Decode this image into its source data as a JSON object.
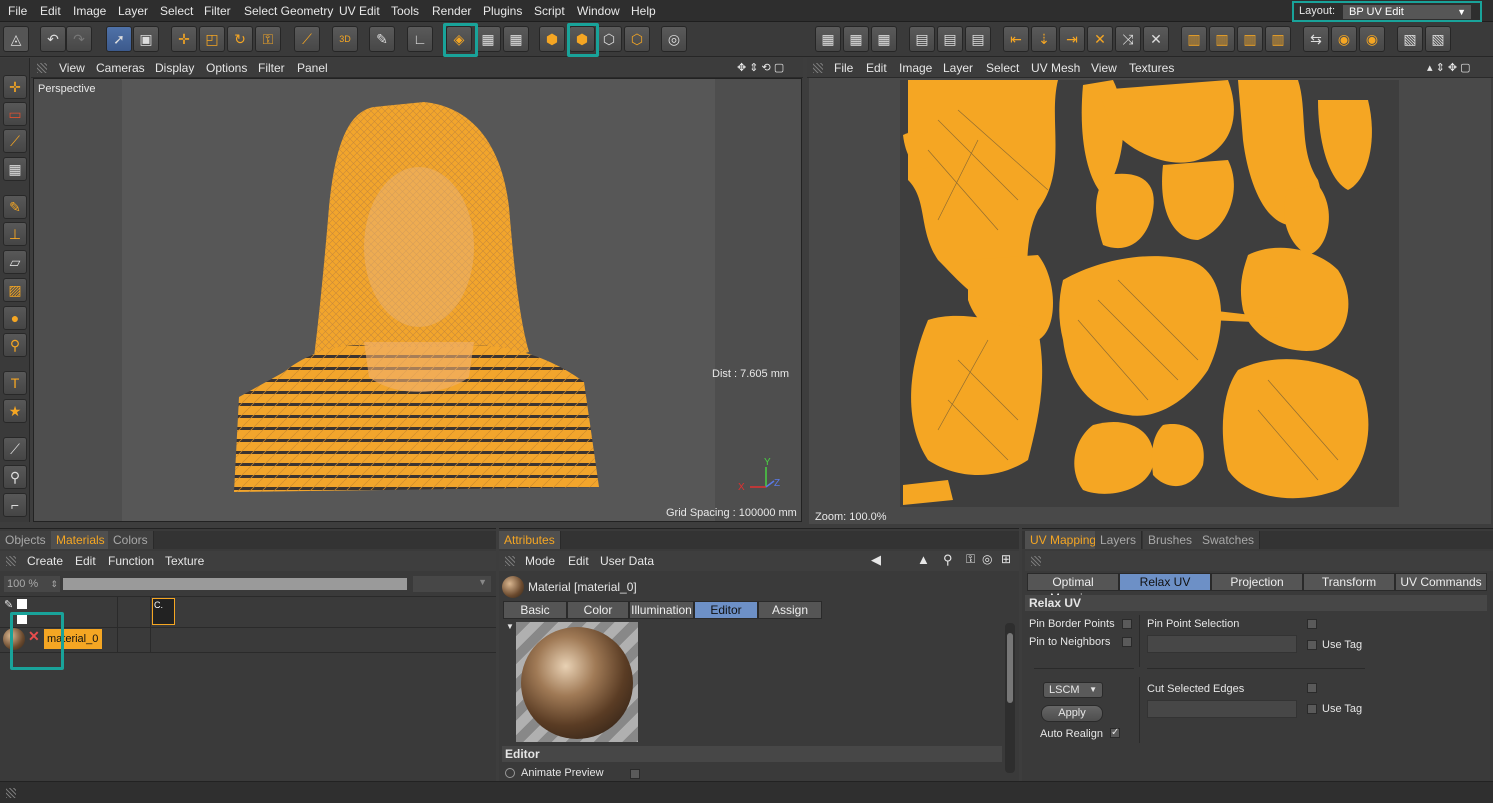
{
  "menubar": {
    "items": [
      "File",
      "Edit",
      "Image",
      "Layer",
      "Select",
      "Filter",
      "Select Geometry",
      "UV Edit",
      "Tools",
      "Render",
      "Plugins",
      "Script",
      "Window",
      "Help"
    ],
    "layout_label": "Layout:",
    "layout_value": "BP UV Edit"
  },
  "viewport": {
    "menu": [
      "View",
      "Cameras",
      "Display",
      "Options",
      "Filter",
      "Panel"
    ],
    "name": "Perspective",
    "dist": "Dist : 7.605 mm",
    "grid_spacing": "Grid Spacing : 100000 mm",
    "axis_y": "Y",
    "axis_x": "X",
    "axis_z": "Z"
  },
  "uv_view": {
    "menu": [
      "File",
      "Edit",
      "Image",
      "Layer",
      "Select",
      "UV Mesh",
      "View",
      "Textures"
    ],
    "zoom": "Zoom: 100.0%"
  },
  "left_panel": {
    "tabs": [
      "Objects",
      "Materials",
      "Colors"
    ],
    "active_tab": "Materials",
    "menu": [
      "Create",
      "Edit",
      "Function",
      "Texture"
    ],
    "zoom_value": "100 %",
    "col_label": "C.",
    "material_name": "material_0"
  },
  "attributes": {
    "tab": "Attributes",
    "menu": [
      "Mode",
      "Edit",
      "User Data"
    ],
    "material_title": "Material [material_0]",
    "subtabs": [
      "Basic",
      "Color",
      "Illumination",
      "Editor",
      "Assign"
    ],
    "active_subtab": "Editor",
    "section": "Editor",
    "animate_preview": "Animate Preview"
  },
  "uv_panel": {
    "tabs": [
      "UV Mapping",
      "Layers",
      "Brushes",
      "Swatches"
    ],
    "active_tab": "UV Mapping",
    "subtabs": [
      "Optimal Mapping",
      "Relax UV",
      "Projection",
      "Transform",
      "UV Commands"
    ],
    "active_subtab": "Relax UV",
    "section": "Relax UV",
    "pin_border": "Pin Border Points",
    "pin_neighbors": "Pin to Neighbors",
    "pin_point_selection": "Pin Point Selection",
    "use_tag": "Use Tag",
    "cut_selected_edges": "Cut Selected Edges",
    "method": "LSCM",
    "apply": "Apply",
    "auto_realign": "Auto Realign",
    "check": "✓"
  },
  "colors": {
    "accent": "#f5a623",
    "highlight": "#19a39a",
    "active_tab_blue": "#6d90c6"
  }
}
